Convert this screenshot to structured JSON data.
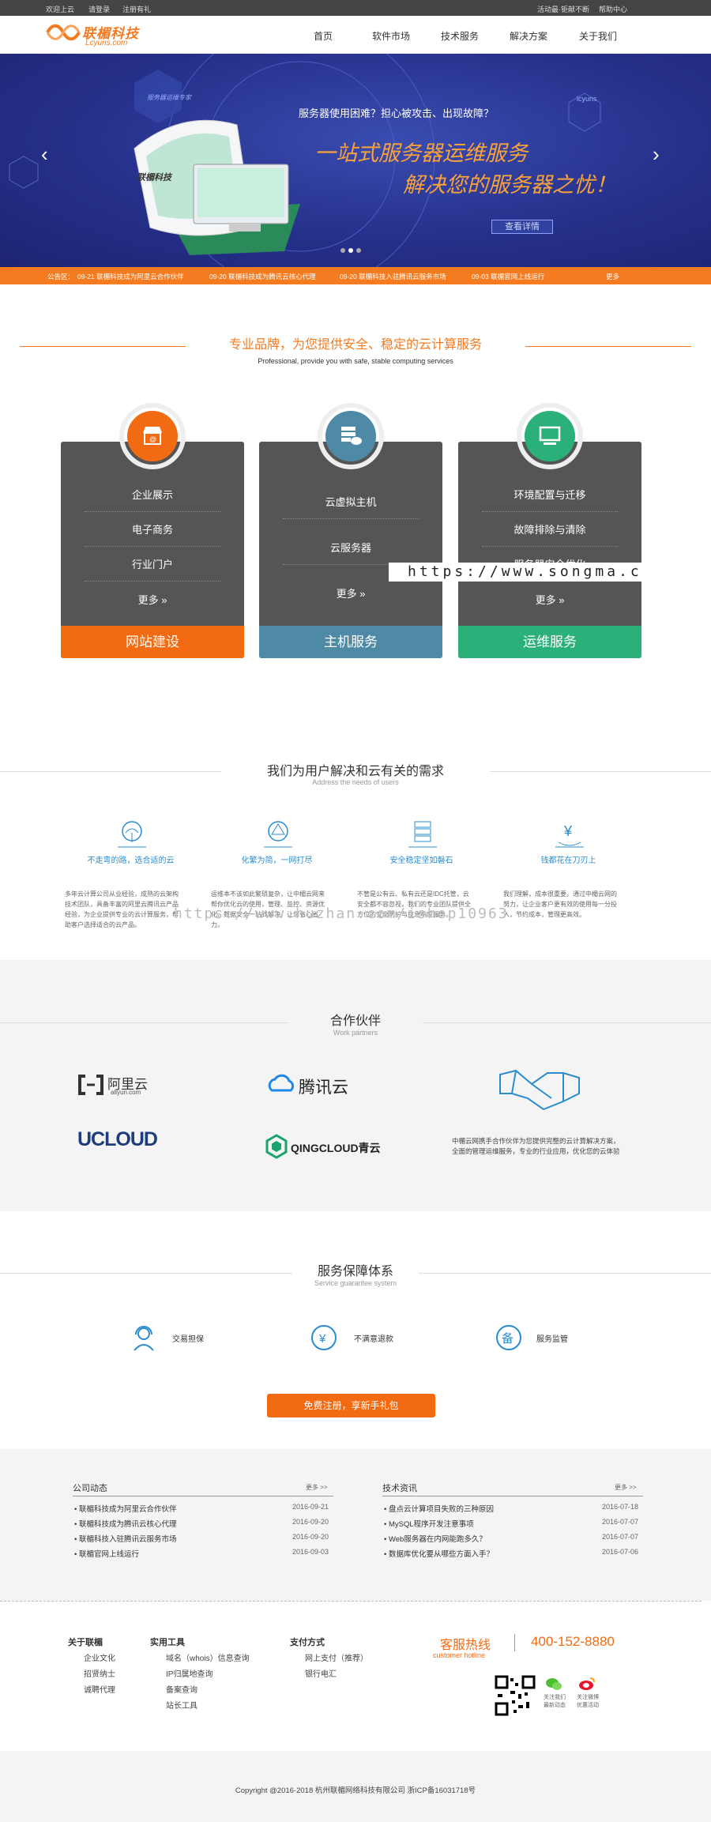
{
  "topbar": {
    "welcome": "欢迎上云",
    "login": "请登录",
    "register": "注册有礼",
    "slogan": "活动最·钜献不断",
    "help": "帮助中心"
  },
  "brand": {
    "name": "联楣科技",
    "domain": "Lcyuns.com"
  },
  "nav": [
    "首页",
    "软件市场",
    "技术服务",
    "解决方案",
    "关于我们"
  ],
  "banner": {
    "question": "服务器使用困难？担心被攻击、出现故障？",
    "headline1": "一站式服务器运维服务",
    "headline2": "解决您的服务器之忧！",
    "cta": "查看详情",
    "prev": "‹",
    "next": "›",
    "badge": "服务器运维专家",
    "badge2": "lcyuns",
    "monitor_logo": "联楣科技"
  },
  "announce": {
    "label": "公告区：",
    "items": [
      "09-21 联楣科技成为阿里云合作伙伴",
      "09-20 联楣科技成为腾讯云核心代理",
      "09-20 联楣科技入驻腾讯云服务市场",
      "09-03 联楣官网上线运行"
    ],
    "more": "更多"
  },
  "services": {
    "title": "专业品牌，为您提供安全、稳定的云计算服务",
    "subtitle": "Professional, provide you with safe, stable computing services",
    "cards": [
      {
        "items": [
          "企业展示",
          "电子商务",
          "行业门户"
        ],
        "more": "更多 »",
        "footer": "网站建设",
        "color": "#f26b12"
      },
      {
        "items": [
          "云虚拟主机",
          "云服务器"
        ],
        "more": "更多 »",
        "footer": "主机服务",
        "color": "#4e8aa6"
      },
      {
        "items": [
          "环境配置与迁移",
          "故障排除与清除",
          "服务器安全优化"
        ],
        "more": "更多 »",
        "footer": "运维服务",
        "color": "#2bb07a"
      }
    ]
  },
  "watermark1": "https://www.songma.c",
  "needs": {
    "title": "我们为用户解决和云有关的需求",
    "subtitle": "Address the needs of users",
    "items": [
      {
        "title": "不走弯的路，选合适的云",
        "desc": "多年云计算公司从业经验，成熟的云架构技术团队，具备丰富的阿里云腾讯云产品经验，为企业提供专业的云计算服务，帮助客户选择适合的云产品。"
      },
      {
        "title": "化繁为简，一网打尽",
        "desc": "运维本不该如此繁琐复杂，让中楣云网来帮你优化云的使用，管理、监控、资源优化、数据安全一站式解决，让您省心省力。"
      },
      {
        "title": "安全稳定坚如磐石",
        "desc": "不管是公有云、私有云还是IDC托管，云安全都不容忽视，我们的专业团队提供全方位的安全防护与应急响应服务。"
      },
      {
        "title": "钱都花在刀刃上",
        "desc": "我们理解，成本很重要。通过中楣云网的努力，让企业客户更有效的使用每一分投入，节约成本，管理更高效。"
      }
    ]
  },
  "watermark2": "https://www.huzhan.com/ishop10963",
  "partners": {
    "title": "合作伙伴",
    "subtitle": "Work partners",
    "aliyun": "阿里云",
    "aliyun_sub": "aliyun.com",
    "tencent": "腾讯云",
    "ucloud": "UCLOUD",
    "qingcloud": "QINGCLOUD青云",
    "desc": "中楣云网携手合作伙伴为您提供完整的云计算解决方案，全面的管理运维服务，专业的行业应用，优化您的云体验"
  },
  "guarantee": {
    "title": "服务保障体系",
    "subtitle": "Service guarantee system",
    "items": [
      "交易担保",
      "不满意退款",
      "服务监管"
    ],
    "cta": "免费注册，享新手礼包"
  },
  "news": {
    "company": {
      "title": "公司动态",
      "more": "更多 >>",
      "items": [
        {
          "t": "联楣科技成为阿里云合作伙伴",
          "d": "2016-09-21"
        },
        {
          "t": "联楣科技成为腾讯云核心代理",
          "d": "2016-09-20"
        },
        {
          "t": "联楣科技入驻腾讯云服务市场",
          "d": "2016-09-20"
        },
        {
          "t": "联楣官网上线运行",
          "d": "2016-09-03"
        }
      ]
    },
    "tech": {
      "title": "技术资讯",
      "more": "更多 >>",
      "items": [
        {
          "t": "盘点云计算项目失败的三种原因",
          "d": "2016-07-18"
        },
        {
          "t": "MySQL程序开发注意事项",
          "d": "2016-07-07"
        },
        {
          "t": "Web服务器在内网能跑多久？",
          "d": "2016-07-07"
        },
        {
          "t": "数据库优化要从哪些方面入手？",
          "d": "2016-07-06"
        }
      ]
    }
  },
  "footer": {
    "cols": [
      {
        "h": "关于联楣",
        "items": [
          "企业文化",
          "招贤纳士",
          "诚聘代理"
        ]
      },
      {
        "h": "实用工具",
        "items": [
          "域名（whois）信息查询",
          "IP归属地查询",
          "备案查询",
          "站长工具"
        ]
      },
      {
        "h": "支付方式",
        "items": [
          "网上支付（推荐）",
          "银行电汇"
        ]
      }
    ],
    "hotline_label": "客服热线",
    "hotline_en": "customer hotline",
    "phone": "400-152-8880",
    "wechat": "关注我们 最新动态",
    "weibo": "关注微博 优惠活动",
    "copyright": "Copyright @2016-2018 杭州联楣网络科技有限公司 浙ICP备16031718号"
  }
}
